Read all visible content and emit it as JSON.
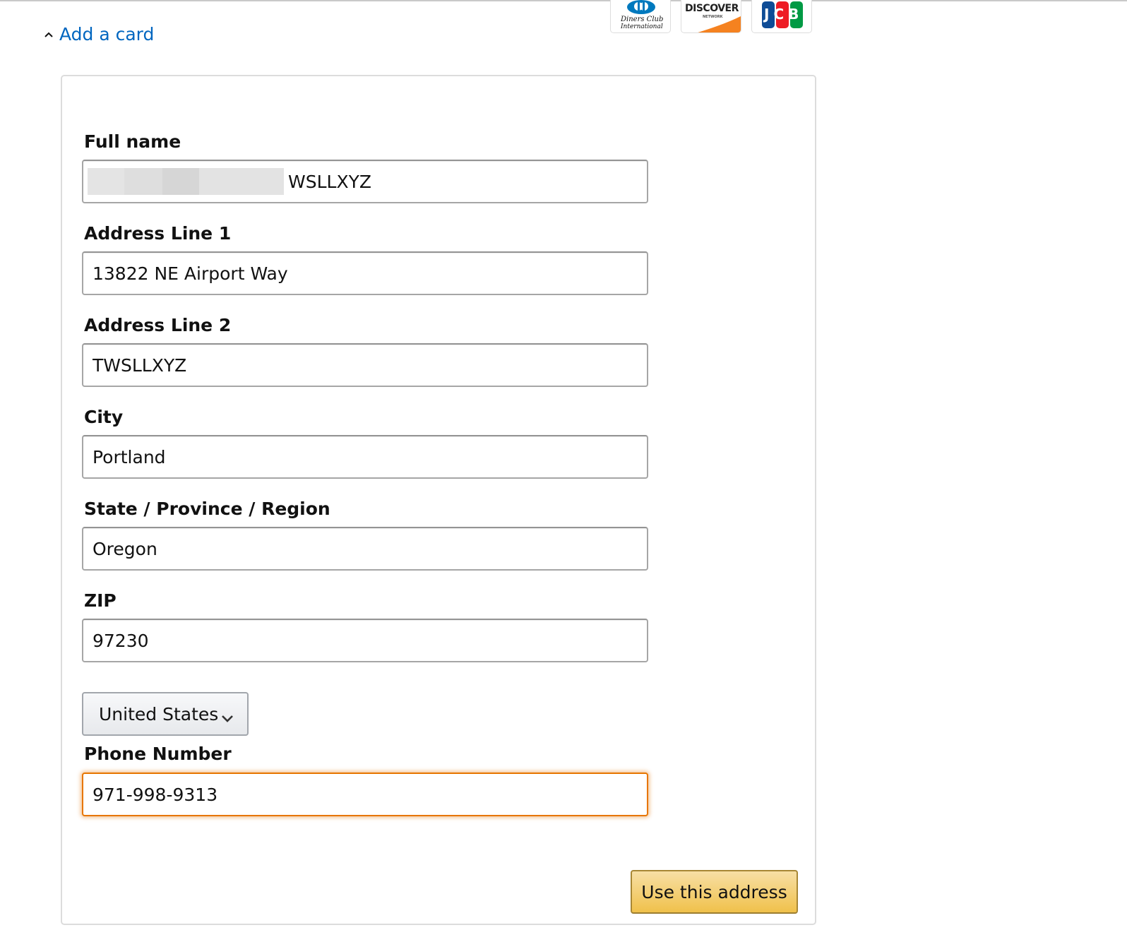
{
  "header": {
    "add_card_label": "Add a card"
  },
  "card_logos": [
    {
      "name": "Diners Club International",
      "line1": "Diners Club",
      "line2": "International",
      "color": "#0079be"
    },
    {
      "name": "Discover",
      "text": "DISCOVER",
      "sub": "NETWORK",
      "color": "#f58220"
    },
    {
      "name": "JCB",
      "text": "JCB",
      "colors": [
        "#0e4c96",
        "#ee1c25",
        "#009a44"
      ]
    }
  ],
  "form": {
    "full_name": {
      "label": "Full name",
      "value": "WSLLXYZ"
    },
    "address1": {
      "label": "Address Line 1",
      "value": "13822 NE Airport Way"
    },
    "address2": {
      "label": "Address Line 2",
      "value": "TWSLLXYZ"
    },
    "city": {
      "label": "City",
      "value": "Portland"
    },
    "state": {
      "label": "State / Province / Region",
      "value": "Oregon"
    },
    "zip": {
      "label": "ZIP",
      "value": "97230"
    },
    "country": {
      "selected": "United States"
    },
    "phone": {
      "label": "Phone Number",
      "value": "971-998-9313"
    },
    "submit_label": "Use this address"
  },
  "colors": {
    "link": "#0066c0",
    "focus": "#e77600",
    "button": "#f0c14b"
  }
}
